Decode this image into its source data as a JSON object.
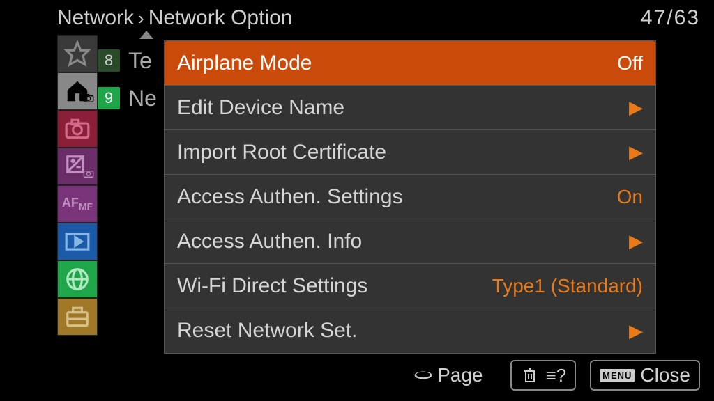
{
  "header": {
    "crumb1": "Network",
    "crumb2": "Network Option",
    "counter": "47/63"
  },
  "bg_list": {
    "item8_badge": "8",
    "item8_label": "Te",
    "item9_badge": "9",
    "item9_label": "Ne"
  },
  "menu": {
    "items": [
      {
        "label": "Airplane Mode",
        "value": "Off",
        "arrow": false,
        "selected": true
      },
      {
        "label": "Edit Device Name",
        "value": "",
        "arrow": true,
        "selected": false
      },
      {
        "label": "Import Root Certificate",
        "value": "",
        "arrow": true,
        "selected": false
      },
      {
        "label": "Access Authen. Settings",
        "value": "On",
        "arrow": false,
        "selected": false
      },
      {
        "label": "Access Authen. Info",
        "value": "",
        "arrow": true,
        "selected": false
      },
      {
        "label": "Wi-Fi Direct Settings",
        "value": "Type1 (Standard)",
        "arrow": false,
        "selected": false
      },
      {
        "label": "Reset Network Set.",
        "value": "",
        "arrow": true,
        "selected": false
      }
    ]
  },
  "footer": {
    "page_label": "Page",
    "help_label": "",
    "close_chip": "MENU",
    "close_label": "Close"
  },
  "colors": {
    "accent": "#e87a1a",
    "selected_bg": "#c94a0a",
    "panel_bg": "#333333"
  }
}
